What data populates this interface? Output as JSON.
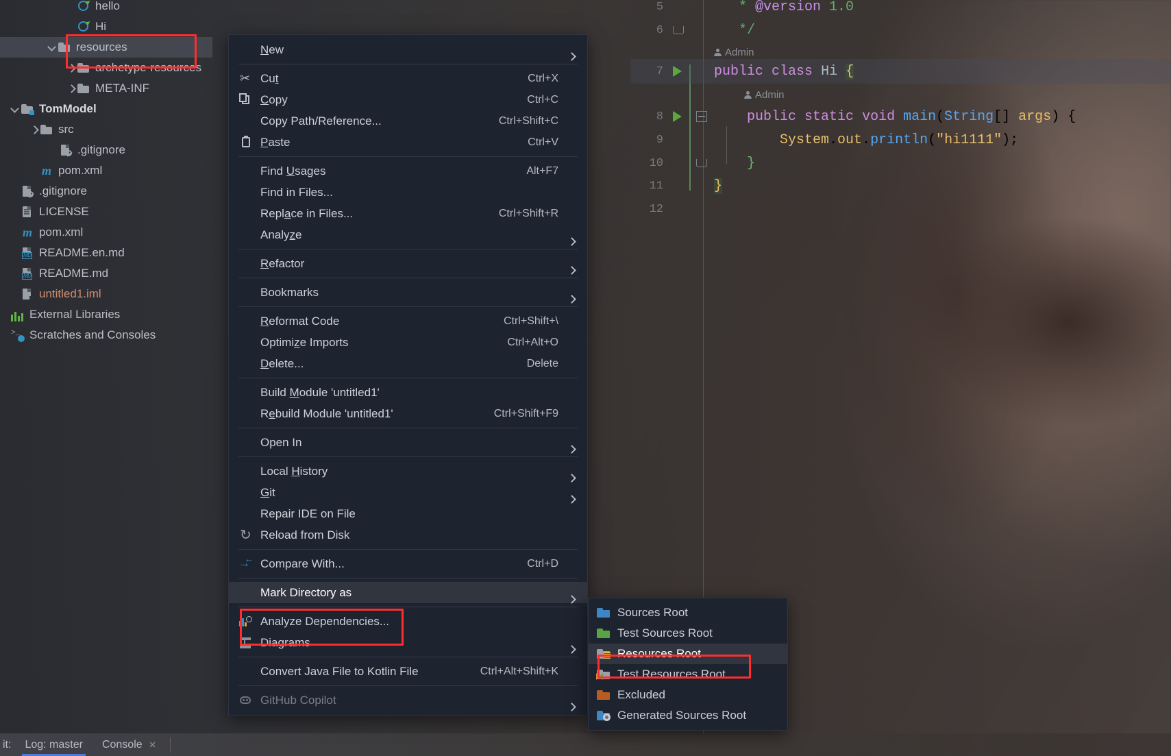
{
  "project_tree": {
    "items": [
      {
        "label": "hello",
        "icon": "java-class-icon",
        "indent": 112,
        "twisty": "none",
        "kind": "class",
        "selected": false
      },
      {
        "label": "Hi",
        "icon": "java-class-icon",
        "indent": 112,
        "twisty": "none",
        "kind": "class",
        "selected": false
      },
      {
        "label": "resources",
        "icon": "folder-icon",
        "indent": 84,
        "twisty": "down",
        "kind": "folder",
        "selected": true
      },
      {
        "label": "archetype-resources",
        "icon": "folder-icon",
        "indent": 112,
        "twisty": "right",
        "kind": "folder",
        "selected": false
      },
      {
        "label": "META-INF",
        "icon": "folder-icon",
        "indent": 112,
        "twisty": "right",
        "kind": "folder",
        "selected": false
      },
      {
        "label": "TomModel",
        "icon": "module-folder-icon",
        "indent": 30,
        "twisty": "down",
        "kind": "module",
        "selected": false
      },
      {
        "label": "src",
        "icon": "folder-icon",
        "indent": 58,
        "twisty": "right",
        "kind": "folder",
        "selected": false
      },
      {
        "label": ".gitignore",
        "icon": "gitignore-file-icon",
        "indent": 86,
        "twisty": "none",
        "kind": "git",
        "selected": false
      },
      {
        "label": "pom.xml",
        "icon": "maven-file-icon",
        "indent": 58,
        "twisty": "none",
        "kind": "maven",
        "selected": false
      },
      {
        "label": ".gitignore",
        "icon": "gitignore-file-icon",
        "indent": 30,
        "twisty": "none",
        "kind": "git",
        "selected": false
      },
      {
        "label": "LICENSE",
        "icon": "text-file-icon",
        "indent": 30,
        "twisty": "none",
        "kind": "license",
        "selected": false
      },
      {
        "label": "pom.xml",
        "icon": "maven-file-icon",
        "indent": 30,
        "twisty": "none",
        "kind": "maven",
        "selected": false
      },
      {
        "label": "README.en.md",
        "icon": "markdown-file-icon",
        "indent": 30,
        "twisty": "none",
        "kind": "md",
        "selected": false
      },
      {
        "label": "README.md",
        "icon": "markdown-file-icon",
        "indent": 30,
        "twisty": "none",
        "kind": "md",
        "selected": false
      },
      {
        "label": "untitled1.iml",
        "icon": "iml-file-icon",
        "indent": 30,
        "twisty": "none",
        "kind": "iml",
        "selected": false
      },
      {
        "label": "External Libraries",
        "icon": "libraries-icon",
        "indent": 10,
        "twisty": "none",
        "kind": "libs",
        "selected": false
      },
      {
        "label": "Scratches and Consoles",
        "icon": "scratches-icon",
        "indent": 10,
        "twisty": "none",
        "kind": "scratch",
        "selected": false
      }
    ]
  },
  "context_menu": {
    "groups": [
      [
        {
          "label": "New",
          "mnemonic": "N",
          "shortcut": "",
          "arrow": true,
          "icon": "",
          "disabled": false,
          "highlighted": false
        }
      ],
      [
        {
          "label": "Cut",
          "mnemonic": "t",
          "shortcut": "Ctrl+X",
          "arrow": false,
          "icon": "scissors-icon",
          "disabled": false,
          "highlighted": false
        },
        {
          "label": "Copy",
          "mnemonic": "C",
          "shortcut": "Ctrl+C",
          "arrow": false,
          "icon": "copy-icon",
          "disabled": false,
          "highlighted": false
        },
        {
          "label": "Copy Path/Reference...",
          "mnemonic": "",
          "shortcut": "Ctrl+Shift+C",
          "arrow": false,
          "icon": "",
          "disabled": false,
          "highlighted": false
        },
        {
          "label": "Paste",
          "mnemonic": "P",
          "shortcut": "Ctrl+V",
          "arrow": false,
          "icon": "paste-icon",
          "disabled": false,
          "highlighted": false
        }
      ],
      [
        {
          "label": "Find Usages",
          "mnemonic": "U",
          "shortcut": "Alt+F7",
          "arrow": false,
          "icon": "",
          "disabled": false,
          "highlighted": false
        },
        {
          "label": "Find in Files...",
          "mnemonic": "",
          "shortcut": "",
          "arrow": false,
          "icon": "",
          "disabled": false,
          "highlighted": false
        },
        {
          "label": "Replace in Files...",
          "mnemonic": "a",
          "shortcut": "Ctrl+Shift+R",
          "arrow": false,
          "icon": "",
          "disabled": false,
          "highlighted": false
        },
        {
          "label": "Analyze",
          "mnemonic": "z",
          "shortcut": "",
          "arrow": true,
          "icon": "",
          "disabled": false,
          "highlighted": false
        }
      ],
      [
        {
          "label": "Refactor",
          "mnemonic": "R",
          "shortcut": "",
          "arrow": true,
          "icon": "",
          "disabled": false,
          "highlighted": false
        }
      ],
      [
        {
          "label": "Bookmarks",
          "mnemonic": "",
          "shortcut": "",
          "arrow": true,
          "icon": "",
          "disabled": false,
          "highlighted": false
        }
      ],
      [
        {
          "label": "Reformat Code",
          "mnemonic": "R",
          "shortcut": "Ctrl+Shift+\\",
          "arrow": false,
          "icon": "",
          "disabled": false,
          "highlighted": false
        },
        {
          "label": "Optimize Imports",
          "mnemonic": "z",
          "shortcut": "Ctrl+Alt+O",
          "arrow": false,
          "icon": "",
          "disabled": false,
          "highlighted": false
        },
        {
          "label": "Delete...",
          "mnemonic": "D",
          "shortcut": "Delete",
          "arrow": false,
          "icon": "",
          "disabled": false,
          "highlighted": false
        }
      ],
      [
        {
          "label": "Build Module 'untitled1'",
          "mnemonic": "M",
          "shortcut": "",
          "arrow": false,
          "icon": "",
          "disabled": false,
          "highlighted": false
        },
        {
          "label": "Rebuild Module 'untitled1'",
          "mnemonic": "e",
          "shortcut": "Ctrl+Shift+F9",
          "arrow": false,
          "icon": "",
          "disabled": false,
          "highlighted": false
        }
      ],
      [
        {
          "label": "Open In",
          "mnemonic": "",
          "shortcut": "",
          "arrow": true,
          "icon": "",
          "disabled": false,
          "highlighted": false
        }
      ],
      [
        {
          "label": "Local History",
          "mnemonic": "H",
          "shortcut": "",
          "arrow": true,
          "icon": "",
          "disabled": false,
          "highlighted": false
        },
        {
          "label": "Git",
          "mnemonic": "G",
          "shortcut": "",
          "arrow": true,
          "icon": "",
          "disabled": false,
          "highlighted": false
        },
        {
          "label": "Repair IDE on File",
          "mnemonic": "",
          "shortcut": "",
          "arrow": false,
          "icon": "",
          "disabled": false,
          "highlighted": false
        },
        {
          "label": "Reload from Disk",
          "mnemonic": "",
          "shortcut": "",
          "arrow": false,
          "icon": "reload-icon",
          "disabled": false,
          "highlighted": false
        }
      ],
      [
        {
          "label": "Compare With...",
          "mnemonic": "",
          "shortcut": "Ctrl+D",
          "arrow": false,
          "icon": "compare-icon",
          "disabled": false,
          "highlighted": false
        }
      ],
      [
        {
          "label": "Mark Directory as",
          "mnemonic": "",
          "shortcut": "",
          "arrow": true,
          "icon": "",
          "disabled": false,
          "highlighted": true
        }
      ],
      [
        {
          "label": "Analyze Dependencies...",
          "mnemonic": "",
          "shortcut": "",
          "arrow": false,
          "icon": "analyze-dependencies-icon",
          "disabled": false,
          "highlighted": false
        },
        {
          "label": "Diagrams",
          "mnemonic": "",
          "shortcut": "",
          "arrow": true,
          "icon": "diagram-icon",
          "disabled": false,
          "highlighted": false
        }
      ],
      [
        {
          "label": "Convert Java File to Kotlin File",
          "mnemonic": "",
          "shortcut": "Ctrl+Alt+Shift+K",
          "arrow": false,
          "icon": "",
          "disabled": false,
          "highlighted": false
        }
      ],
      [
        {
          "label": "GitHub Copilot",
          "mnemonic": "",
          "shortcut": "",
          "arrow": true,
          "icon": "copilot-icon",
          "disabled": true,
          "highlighted": false
        }
      ]
    ]
  },
  "submenu": {
    "title": "Mark Directory as",
    "items": [
      {
        "label": "Sources Root",
        "icon": "folder-blue-icon",
        "highlighted": false
      },
      {
        "label": "Test Sources Root",
        "icon": "folder-green-icon",
        "highlighted": false
      },
      {
        "label": "Resources Root",
        "icon": "folder-resources-icon",
        "highlighted": true
      },
      {
        "label": "Test Resources Root",
        "icon": "folder-test-resources-icon",
        "highlighted": false
      },
      {
        "label": "Excluded",
        "icon": "folder-orange-icon",
        "highlighted": false
      },
      {
        "label": "Generated Sources Root",
        "icon": "folder-generated-icon",
        "highlighted": false
      }
    ]
  },
  "editor": {
    "lines": [
      {
        "num": "5",
        "type": "code",
        "tokens": [
          {
            "t": "   * ",
            "c": "cmt"
          },
          {
            "t": "@version",
            "c": "at"
          },
          {
            "t": " 1.0",
            "c": "cmt"
          }
        ]
      },
      {
        "num": "6",
        "type": "code",
        "fold": "bot",
        "tokens": [
          {
            "t": "   */",
            "c": "cmt"
          }
        ]
      },
      {
        "num": "",
        "type": "hint",
        "text": "Admin",
        "indent": 0
      },
      {
        "num": "7",
        "type": "code",
        "run": true,
        "current": true,
        "tokens": [
          {
            "t": "public",
            "c": "kw"
          },
          {
            "t": " ",
            "c": "pl"
          },
          {
            "t": "class",
            "c": "kw"
          },
          {
            "t": " ",
            "c": "pl"
          },
          {
            "t": "Hi",
            "c": "typ"
          },
          {
            "t": " ",
            "c": "pl"
          },
          {
            "t": "{",
            "c": "br-hl"
          }
        ]
      },
      {
        "num": "",
        "type": "hint",
        "text": "Admin",
        "indent": 44
      },
      {
        "num": "8",
        "type": "code",
        "run": true,
        "fold": "minus",
        "tokens": [
          {
            "t": "    ",
            "c": "pl"
          },
          {
            "t": "public",
            "c": "kw"
          },
          {
            "t": " ",
            "c": "pl"
          },
          {
            "t": "static",
            "c": "kw"
          },
          {
            "t": " ",
            "c": "pl"
          },
          {
            "t": "void",
            "c": "kw"
          },
          {
            "t": " ",
            "c": "pl"
          },
          {
            "t": "main",
            "c": "fn"
          },
          {
            "t": "(",
            "c": "pl"
          },
          {
            "t": "String",
            "c": "fn"
          },
          {
            "t": "[] ",
            "c": "pl"
          },
          {
            "t": "args",
            "c": "str"
          },
          {
            "t": ") {",
            "c": "pl"
          }
        ]
      },
      {
        "num": "9",
        "type": "code",
        "tokens": [
          {
            "t": "        ",
            "c": "pl"
          },
          {
            "t": "System",
            "c": "str"
          },
          {
            "t": ".",
            "c": "pl"
          },
          {
            "t": "out",
            "c": "str"
          },
          {
            "t": ".",
            "c": "pl"
          },
          {
            "t": "println",
            "c": "fn"
          },
          {
            "t": "(",
            "c": "pl"
          },
          {
            "t": "\"hi1111\"",
            "c": "str"
          },
          {
            "t": ");",
            "c": "pl"
          }
        ]
      },
      {
        "num": "10",
        "type": "code",
        "fold": "bot",
        "tokens": [
          {
            "t": "    }",
            "c": "num"
          }
        ]
      },
      {
        "num": "11",
        "type": "code",
        "tokens": [
          {
            "t": "}",
            "c": "br-hl2"
          }
        ]
      },
      {
        "num": "12",
        "type": "code",
        "tokens": []
      }
    ]
  },
  "bottom_bar": {
    "prefix_label": "it:",
    "tabs": [
      {
        "label": "Log: master",
        "active": true,
        "closable": false
      },
      {
        "label": "Console",
        "active": false,
        "closable": true
      }
    ],
    "close_glyph": "×"
  },
  "colors": {
    "accent_red": "#ff2d2d",
    "menu_bg": "#1e2330",
    "menu_highlight": "#31353f",
    "tab_underline": "#4a7ddb",
    "run_arrow_green": "#5ba83d"
  }
}
